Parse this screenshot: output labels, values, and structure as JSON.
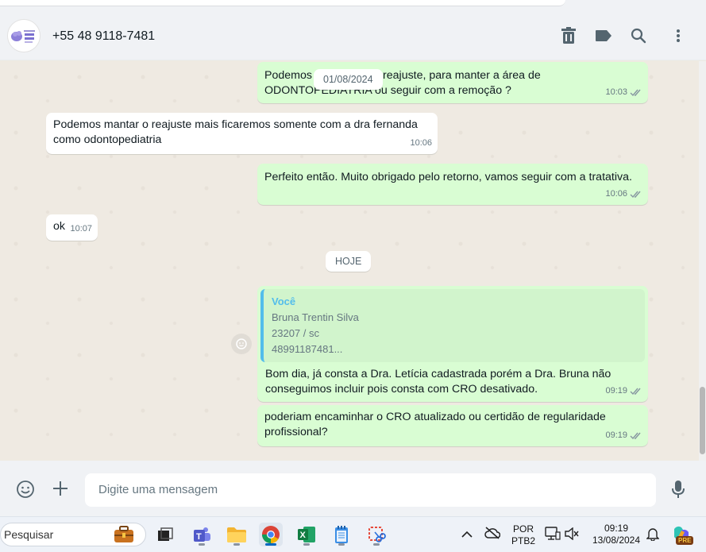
{
  "header": {
    "contact": "+55 48 9118-7481",
    "avatar_icon": "clinic-logo",
    "icons": [
      "trash-icon",
      "label-icon",
      "search-icon",
      "more-icon"
    ]
  },
  "messages": {
    "m1": {
      "text": "Podemos seguir com o reajuste, para manter a área de ODONTOPEDIATRIA ou seguir com a remoção ?",
      "time": "10:03"
    },
    "m2": {
      "text": "Podemos mantar o reajuste mais ficaremos somente com a dra fernanda como odontopediatria",
      "time": "10:06"
    },
    "m3": {
      "text": "Perfeito então. Muito obrigado pelo retorno, vamos seguir com a tratativa.",
      "time": "10:06"
    },
    "m4": {
      "text": "ok",
      "time": "10:07"
    },
    "m5": {
      "quote_author": "Você",
      "quote_line1": "Bruna Trentin Silva",
      "quote_line2": "23207 / sc",
      "quote_line3": "48991187481...",
      "text": "Bom dia, já consta a Dra. Letícia cadastrada porém a Dra. Bruna não conseguimos incluir pois consta com CRO desativado.",
      "time": "09:19"
    },
    "m6": {
      "text": "poderiam encaminhar o CRO atualizado ou certidão de regularidade profissional?",
      "time": "09:19"
    }
  },
  "date_chips": {
    "floating": "01/08/2024",
    "today": "HOJE"
  },
  "composer": {
    "placeholder": "Digite uma mensagem"
  },
  "taskbar": {
    "search_label": "Pesquisar",
    "lang_line1": "POR",
    "lang_line2": "PTB2",
    "clock_time": "09:19",
    "clock_date": "13/08/2024",
    "copilot_badge": "PRE"
  },
  "colors": {
    "outgoing": "#d9fdd3",
    "incoming": "#ffffff",
    "accent": "#53bdeb",
    "chat_bg": "#efeae2"
  }
}
